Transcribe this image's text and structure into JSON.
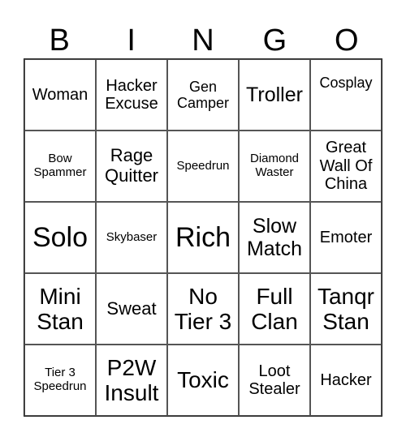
{
  "header": [
    "B",
    "I",
    "N",
    "G",
    "O"
  ],
  "cells": [
    "Woman",
    "Hacker Excuse",
    "Gen Camper",
    "Troller",
    "Cosplay",
    "Bow Spammer",
    "Rage Quitter",
    "Speedrun",
    "Diamond Waster",
    "Great Wall Of China",
    "Solo",
    "Skybaser",
    "Rich",
    "Slow Match",
    "Emoter",
    "Mini Stan",
    "Sweat",
    "No Tier 3",
    "Full Clan",
    "Tanqr Stan",
    "Tier 3 Speedrun",
    "P2W Insult",
    "Toxic",
    "Loot Stealer",
    "Hacker"
  ]
}
